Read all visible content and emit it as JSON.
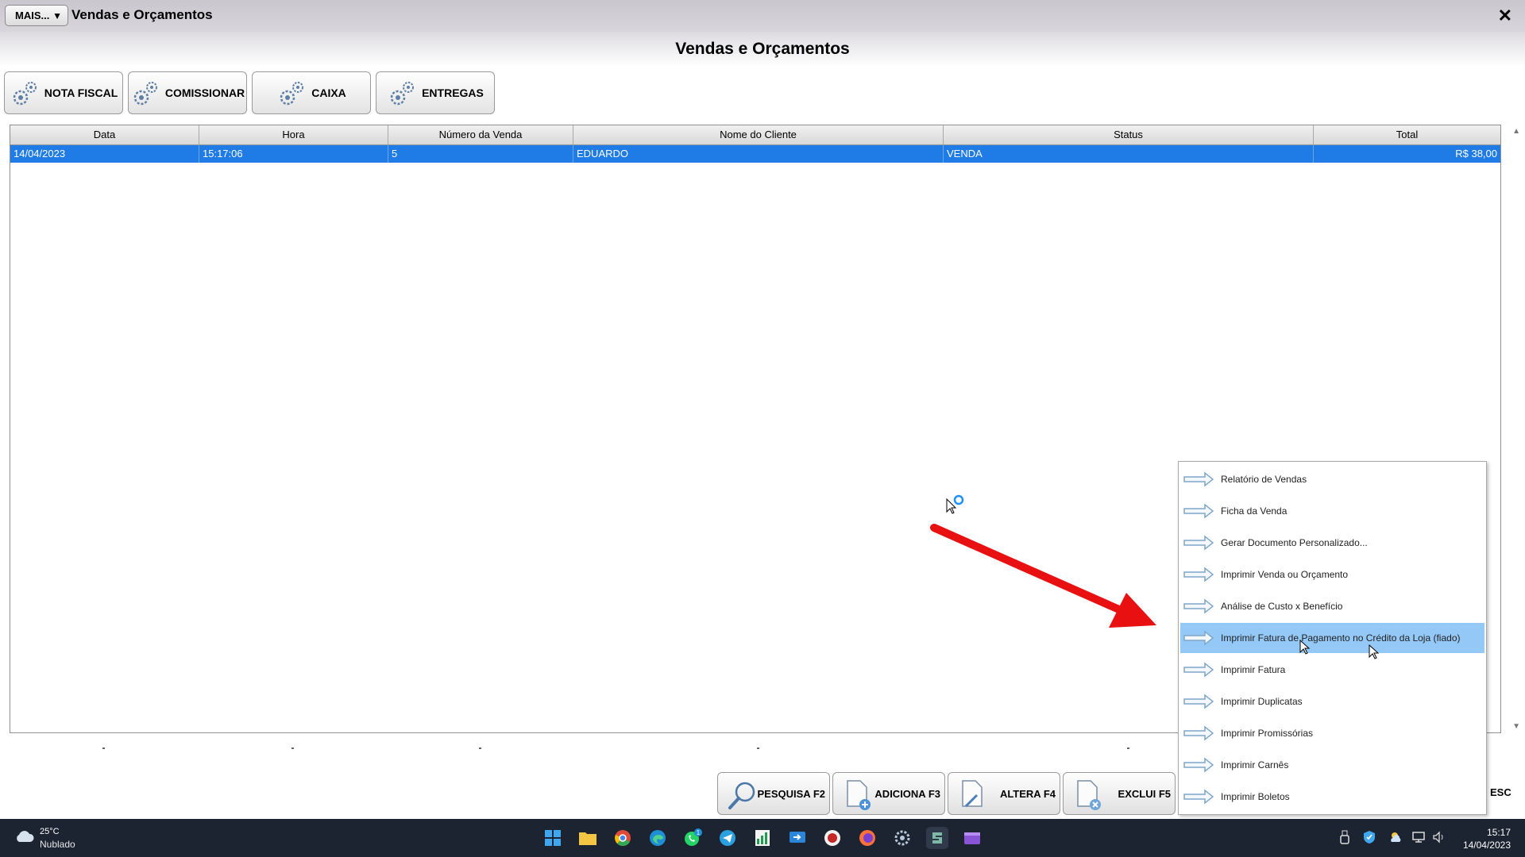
{
  "window": {
    "mais_label": "MAIS...",
    "title": "Vendas e Orçamentos",
    "heading": "Vendas e Orçamentos"
  },
  "toolbar": [
    {
      "label": "NOTA FISCAL"
    },
    {
      "label": "COMISSIONAR"
    },
    {
      "label": "CAIXA"
    },
    {
      "label": "ENTREGAS"
    }
  ],
  "table": {
    "columns": [
      "Data",
      "Hora",
      "Número da Venda",
      "Nome do Cliente",
      "Status",
      "Total"
    ],
    "rows": [
      {
        "data": "14/04/2023",
        "hora": "15:17:06",
        "numero": "5",
        "cliente": "EDUARDO",
        "status": "VENDA",
        "total": "R$ 38,00"
      }
    ]
  },
  "context_menu": {
    "items": [
      "Relatório de Vendas",
      "Ficha da Venda",
      "Gerar Documento Personalizado...",
      "Imprimir Venda ou Orçamento",
      "Análise de Custo x Benefício",
      "Imprimir Fatura de Pagamento no Crédito da Loja (fiado)",
      "Imprimir Fatura",
      "Imprimir Duplicatas",
      "Imprimir Promissórias",
      "Imprimir Carnês",
      "Imprimir Boletos"
    ],
    "highlighted": "Imprimir Fatura de Pagamento no Crédito da Loja (fiado)"
  },
  "bottom_buttons": [
    {
      "label": "PESQUISA F2"
    },
    {
      "label": "ADICIONA F3"
    },
    {
      "label": "ALTERA F4"
    },
    {
      "label": "EXCLUI F5"
    }
  ],
  "esc_label": "ESC",
  "taskbar": {
    "weather_temp": "25°C",
    "weather_desc": "Nublado",
    "time": "15:17",
    "date": "14/04/2023",
    "whatsapp_badge": "1"
  },
  "colors": {
    "selection": "#1f7be6",
    "menu_highlight": "#93c8f7",
    "arrow": "#e81010",
    "taskbar": "#1b2430"
  }
}
